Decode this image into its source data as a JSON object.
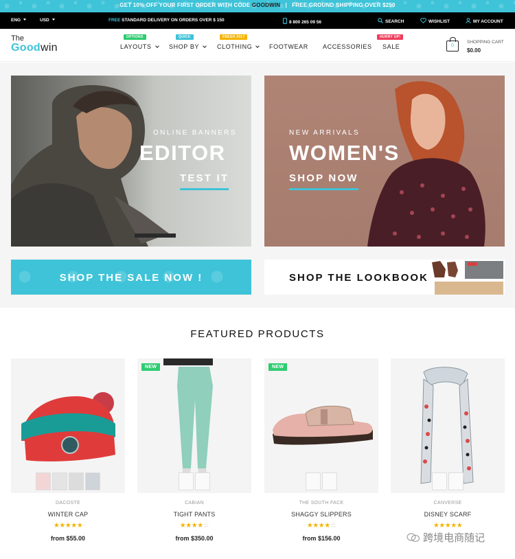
{
  "promo": {
    "text_before": "GET 10% OFF YOUR FIRST ORDER WITH CODE ",
    "code": "GOODWIN",
    "text_after": "   |   FREE GROUND SHIPPING OVER $250"
  },
  "topbar": {
    "language": "ENG",
    "currency": "USD",
    "shipping_free": "FREE",
    "shipping_rest": " STANDARD DELIVERY ON ORDERS OVER $ 150",
    "phone": "8 800 265 09 56",
    "search_label": "SEARCH",
    "wishlist_label": "WISHLIST",
    "account_label": "MY ACCOUNT"
  },
  "header": {
    "logo_the": "The",
    "logo_good": "Good",
    "logo_win": "win",
    "nav": [
      {
        "label": "LAYOUTS",
        "badge": "OPTIONS",
        "badge_color": "#2ecc71"
      },
      {
        "label": "SHOP BY",
        "badge": "QUICK",
        "badge_color": "#3ec3d8"
      },
      {
        "label": "CLOTHING",
        "badge": "FRESH 2017",
        "badge_color": "#f5b400"
      },
      {
        "label": "FOOTWEAR"
      },
      {
        "label": "ACCESSORIES"
      },
      {
        "label": "SALE",
        "badge": "HURRY UP!",
        "badge_color": "#ef3e5c"
      }
    ],
    "cart": {
      "label": "SHOPPING CART",
      "count": "0",
      "amount": "$0.00"
    }
  },
  "banners": {
    "left": {
      "small": "ONLINE BANNERS",
      "big": "EDITOR",
      "link": "TEST IT"
    },
    "right": {
      "small": "NEW ARRIVALS",
      "big": "WOMEN'S",
      "link": "SHOP NOW"
    },
    "sale_button": "SHOP THE SALE NOW !",
    "lookbook_button": "SHOP THE LOOKBOOK"
  },
  "featured": {
    "title": "FEATURED PRODUCTS",
    "products": [
      {
        "brand": "DACOSTE",
        "name": "WINTER CAP",
        "rating": 5,
        "price": "from $55.00",
        "new": false
      },
      {
        "brand": "CABIAN",
        "name": "TIGHT PANTS",
        "rating": 4,
        "price": "from $350.00",
        "new": true,
        "new_label": "NEW"
      },
      {
        "brand": "THE SOUTH FACE",
        "name": "SHAGGY SLIPPERS",
        "rating": 4,
        "price": "from $156.00",
        "new": true,
        "new_label": "NEW"
      },
      {
        "brand": "CANVERSE",
        "name": "DISNEY SCARF",
        "rating": 5,
        "price": "",
        "new": false
      }
    ]
  },
  "watermark": "跨境电商随记",
  "colors": {
    "accent": "#3ec3d8",
    "new_badge": "#2ecc71",
    "star": "#f5b400"
  }
}
